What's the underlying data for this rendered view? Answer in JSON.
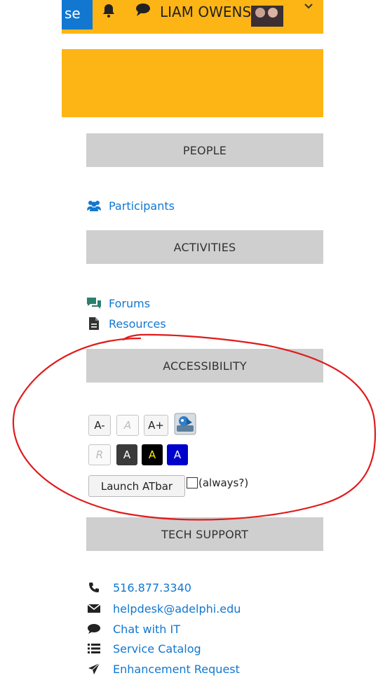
{
  "header": {
    "button_label": "se",
    "user_name": "LIAM OWENS",
    "icons": [
      "bell-icon",
      "chat-bubble-icon",
      "chevron-down-icon"
    ]
  },
  "sections": {
    "people": {
      "title": "PEOPLE",
      "links": [
        {
          "label": "Participants",
          "icon": "users-icon"
        }
      ]
    },
    "activities": {
      "title": "ACTIVITIES",
      "links": [
        {
          "label": "Forums",
          "icon": "forum-chat-icon"
        },
        {
          "label": "Resources",
          "icon": "file-icon"
        }
      ]
    },
    "accessibility": {
      "title": "ACCESSIBILITY",
      "row1": [
        "A-",
        "A",
        "A+"
      ],
      "row2": [
        "R",
        "A",
        "A",
        "A"
      ],
      "launch_label": "Launch ATbar",
      "always_label": "(always?)",
      "always_checked": false
    },
    "tech_support": {
      "title": "TECH SUPPORT",
      "links": [
        {
          "label": "516.877.3340",
          "icon": "phone-icon"
        },
        {
          "label": "helpdesk@adelphi.edu",
          "icon": "envelope-icon"
        },
        {
          "label": "Chat with IT",
          "icon": "chat-bubble-icon"
        },
        {
          "label": "Service Catalog",
          "icon": "list-icon"
        },
        {
          "label": "Enhancement Request",
          "icon": "paper-plane-icon"
        }
      ]
    }
  },
  "colors": {
    "brand_yellow": "#FDB515",
    "link_blue": "#1177d1",
    "section_gray": "#cfcfcf",
    "annotation_red": "#e01b1b"
  }
}
